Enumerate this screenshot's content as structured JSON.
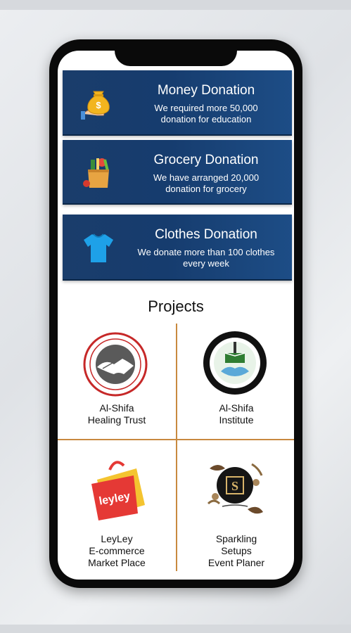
{
  "donations": [
    {
      "title": "Money Donation",
      "line1": "We required more 50,000",
      "line2": "donation for education",
      "icon": "money-bag-icon"
    },
    {
      "title": "Grocery Donation",
      "line1": "We have arranged 20,000",
      "line2": "donation for grocery",
      "icon": "grocery-bag-icon"
    },
    {
      "title": "Clothes Donation",
      "line1": "We donate more than 100 clothes",
      "line2": "every week",
      "icon": "tshirt-icon"
    }
  ],
  "projects": {
    "title": "Projects",
    "items": [
      {
        "label": "Al-Shifa\nHealing Trust",
        "logo": "handshake-seal-logo"
      },
      {
        "label": "Al-Shifa\nInstitute",
        "logo": "institute-seal-logo"
      },
      {
        "label": "LeyLey\nE-commerce\nMarket Place",
        "logo": "shopping-bag-logo",
        "logo_text": "leyley"
      },
      {
        "label": "Sparkling\nSetups\nEvent Planer",
        "logo": "sparkling-floral-logo"
      }
    ]
  },
  "colors": {
    "card_bg": "#163c6e",
    "divider": "#c8893f",
    "text": "#111111"
  }
}
